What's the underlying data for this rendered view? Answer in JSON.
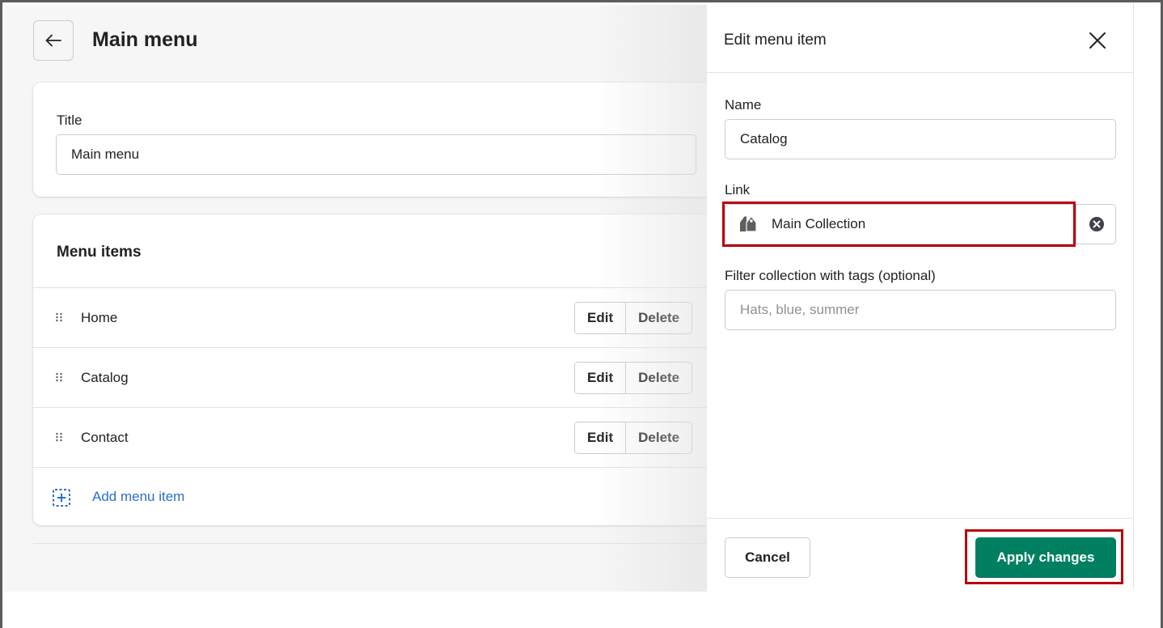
{
  "page": {
    "title": "Main menu"
  },
  "title_card": {
    "label": "Title",
    "value": "Main menu"
  },
  "menu_card": {
    "heading": "Menu items",
    "items": [
      {
        "label": "Home",
        "edit": "Edit",
        "delete": "Delete"
      },
      {
        "label": "Catalog",
        "edit": "Edit",
        "delete": "Delete"
      },
      {
        "label": "Contact",
        "edit": "Edit",
        "delete": "Delete"
      }
    ],
    "add_label": "Add menu item"
  },
  "panel": {
    "title": "Edit menu item",
    "name_label": "Name",
    "name_value": "Catalog",
    "link_label": "Link",
    "link_value": "Main Collection",
    "filter_label": "Filter collection with tags (optional)",
    "filter_placeholder": "Hats, blue, summer",
    "cancel_label": "Cancel",
    "apply_label": "Apply changes"
  },
  "icons": {
    "back": "arrow-left-icon",
    "close": "close-icon",
    "drag": "drag-handle-icon",
    "add": "add-plus-dashed-icon",
    "link_type": "collection-tag-icon",
    "clear": "circle-x-icon"
  },
  "colors": {
    "primary_button": "#008060",
    "link_text": "#2c6ecb",
    "highlight_outline": "#b7050b",
    "background": "#f6f6f7"
  }
}
